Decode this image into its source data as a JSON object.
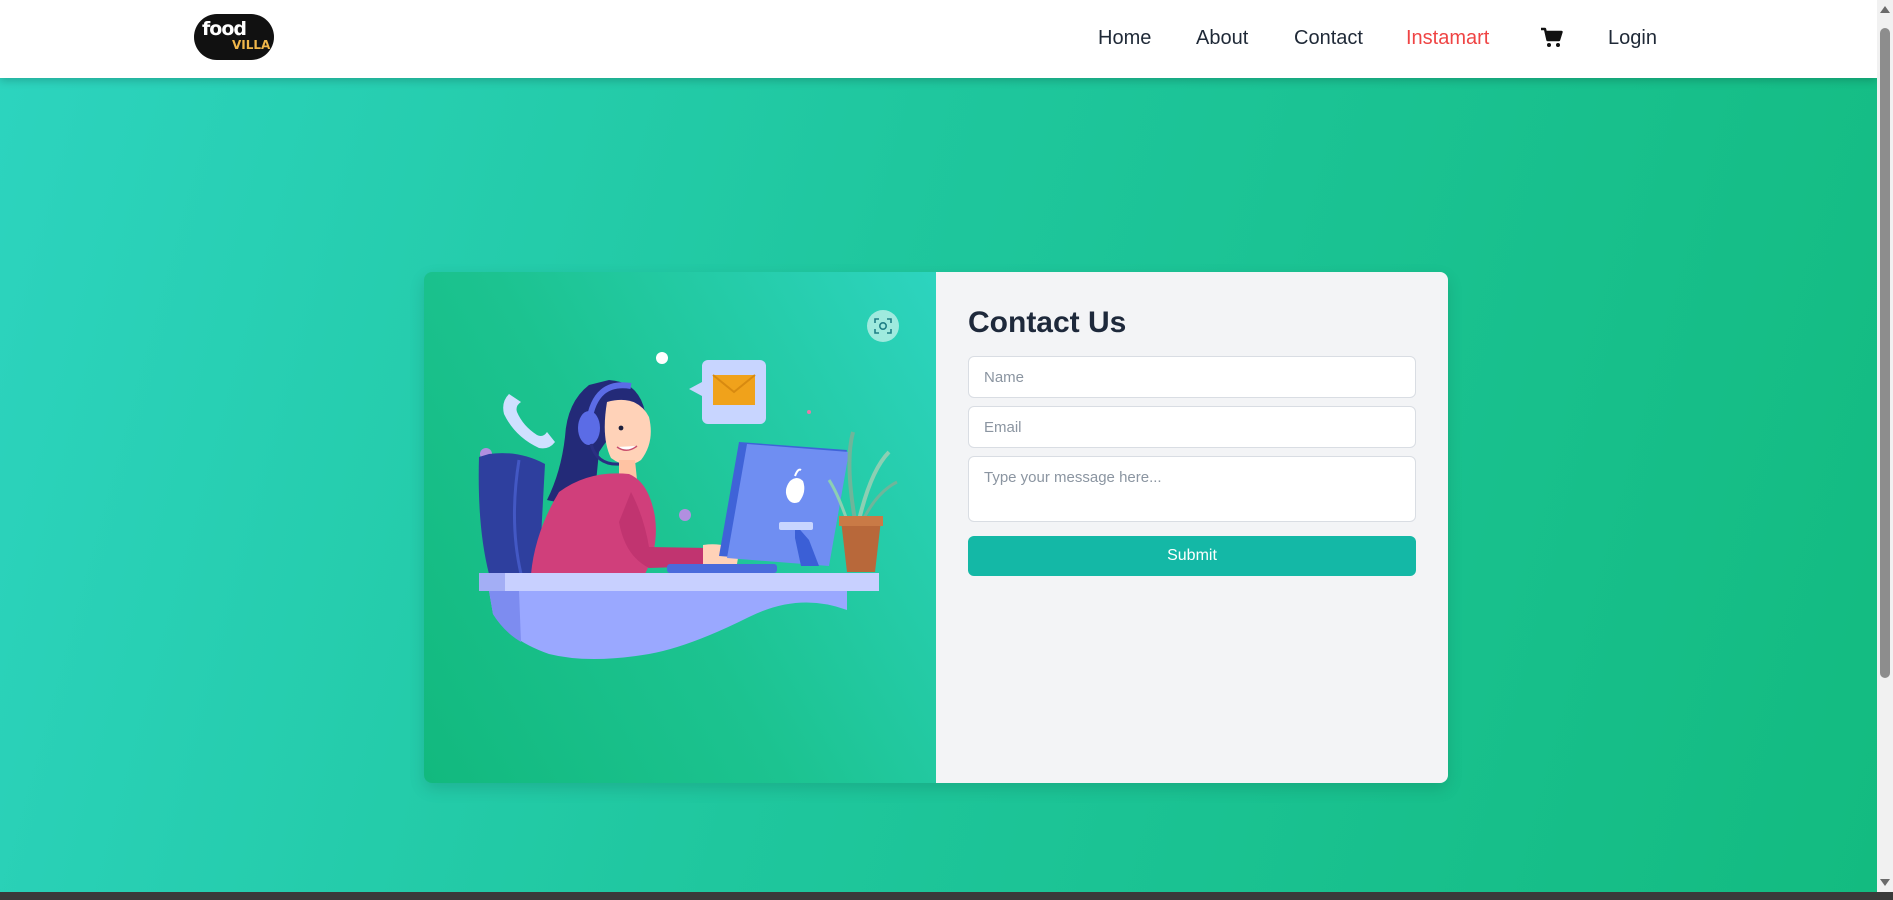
{
  "header": {
    "logo": {
      "text_top": "food",
      "text_bottom": "VILLA"
    },
    "nav": [
      {
        "label": "Home"
      },
      {
        "label": "About"
      },
      {
        "label": "Contact"
      },
      {
        "label": "Instamart",
        "active": true
      },
      {
        "label": "Login"
      }
    ],
    "cart_icon": "cart-icon",
    "active_color": "#ef4444"
  },
  "contact": {
    "title": "Contact Us",
    "name_placeholder": "Name",
    "email_placeholder": "Email",
    "message_placeholder": "Type your message here...",
    "submit_label": "Submit"
  },
  "colors": {
    "accent": "#14b8a6",
    "background_gradient": [
      "#2dd4bf",
      "#13bb80"
    ]
  }
}
